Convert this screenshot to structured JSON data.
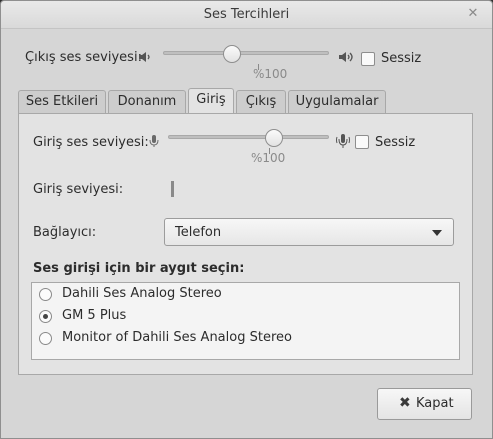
{
  "window": {
    "title": "Ses Tercihleri"
  },
  "output": {
    "label": "Çıkış ses seviyesi:",
    "percent_label": "%100",
    "mute_label": "Sessiz",
    "level_fraction": 0.42,
    "muted": false
  },
  "tabs": [
    {
      "label": "Ses Etkileri",
      "active": false
    },
    {
      "label": "Donanım",
      "active": false
    },
    {
      "label": "Giriş",
      "active": true
    },
    {
      "label": "Çıkış",
      "active": false
    },
    {
      "label": "Uygulamalar",
      "active": false
    }
  ],
  "input": {
    "volume_label": "Giriş ses seviyesi:",
    "percent_label": "%100",
    "mute_label": "Sessiz",
    "level_fraction": 0.68,
    "level_label": "Giriş seviyesi:",
    "connector_label": "Bağlayıcı:",
    "connector_value": "Telefon",
    "device_heading": "Ses girişi için bir aygıt seçin:",
    "devices": [
      {
        "label": "Dahili Ses Analog Stereo",
        "selected": false
      },
      {
        "label": "GM 5 Plus",
        "selected": true
      },
      {
        "label": "Monitor of Dahili Ses Analog Stereo",
        "selected": false
      }
    ]
  },
  "footer": {
    "close_label": "Kapat",
    "close_icon": "✖"
  },
  "icons": {
    "volume_low": "speaker-low-icon",
    "volume_high": "speaker-high-icon",
    "mic_low": "microphone-low-icon",
    "mic_high": "microphone-high-icon"
  }
}
